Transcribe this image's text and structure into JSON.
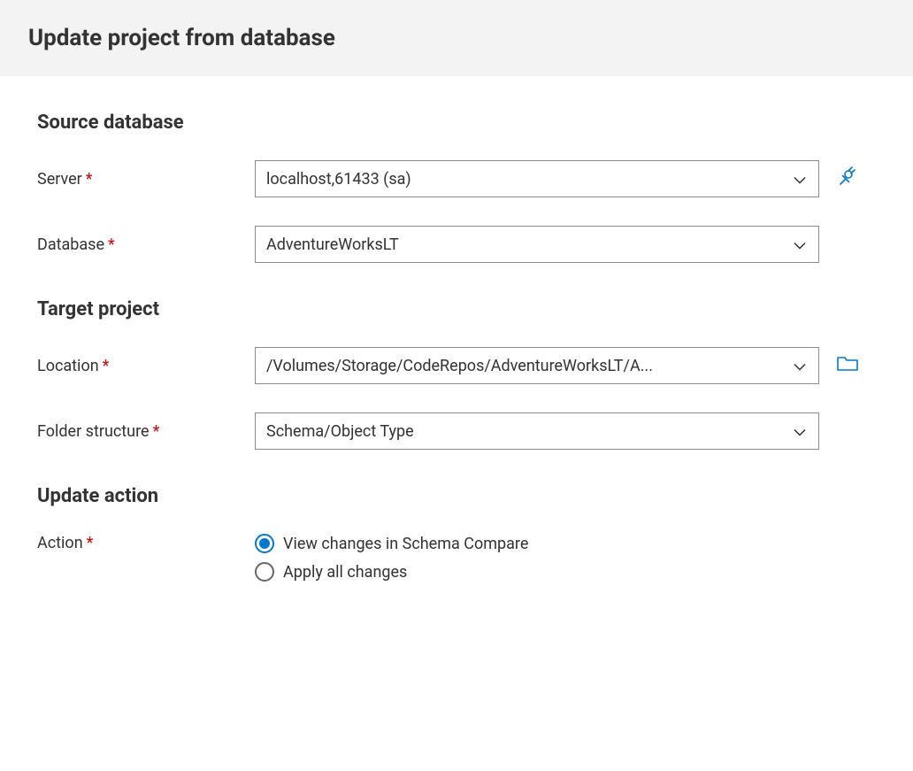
{
  "header": {
    "title": "Update project from database"
  },
  "sourceDatabase": {
    "title": "Source database",
    "serverLabel": "Server",
    "serverValue": "localhost,61433 (sa)",
    "databaseLabel": "Database",
    "databaseValue": "AdventureWorksLT"
  },
  "targetProject": {
    "title": "Target project",
    "locationLabel": "Location",
    "locationValue": "/Volumes/Storage/CodeRepos/AdventureWorksLT/A...",
    "folderStructureLabel": "Folder structure",
    "folderStructureValue": "Schema/Object Type"
  },
  "updateAction": {
    "title": "Update action",
    "actionLabel": "Action",
    "option1": "View changes in Schema Compare",
    "option2": "Apply all changes"
  }
}
